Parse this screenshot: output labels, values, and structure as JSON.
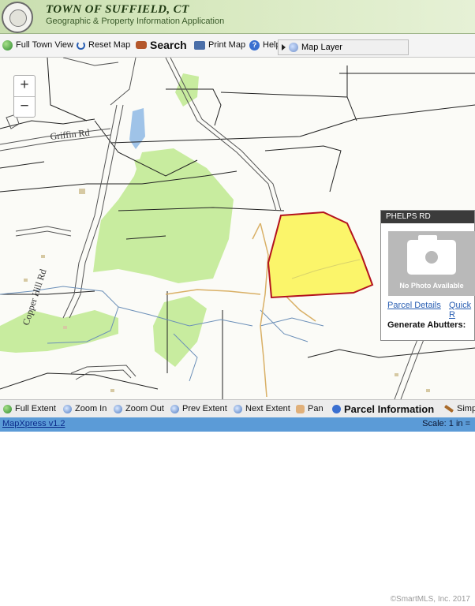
{
  "banner": {
    "title": "TOWN OF SUFFIELD, CT",
    "subtitle": "Geographic & Property Information Application",
    "seal_icon": "town-seal-icon"
  },
  "toolbar": {
    "full_town_view": "Full Town View",
    "reset_map": "Reset Map",
    "search": "Search",
    "print_map": "Print Map",
    "help": "Help",
    "map_layer": "Map Layer"
  },
  "map": {
    "roads": [
      "Griffin Rd",
      "Copper Hill Rd"
    ],
    "highlight_color": "#fbf56a",
    "parcel_outline_color": "#b3121e",
    "wetland_color": "#c8ec9f"
  },
  "zoom": {
    "plus": "+",
    "minus": "−"
  },
  "popup": {
    "title": "PHELPS RD",
    "photo_text": "No Photo Available",
    "parcel_details": "Parcel Details",
    "quick_link": "Quick R",
    "generate_abutters": "Generate Abutters:"
  },
  "bottom_toolbar": {
    "full_extent": "Full Extent",
    "zoom_in": "Zoom In",
    "zoom_out": "Zoom Out",
    "prev_extent": "Prev Extent",
    "next_extent": "Next Extent",
    "pan": "Pan",
    "parcel_information": "Parcel Information",
    "simple": "Simp"
  },
  "status": {
    "version": "MapXpress v1.2",
    "scale": "Scale: 1 in ="
  },
  "copyright": "©SmartMLS, Inc. 2017"
}
